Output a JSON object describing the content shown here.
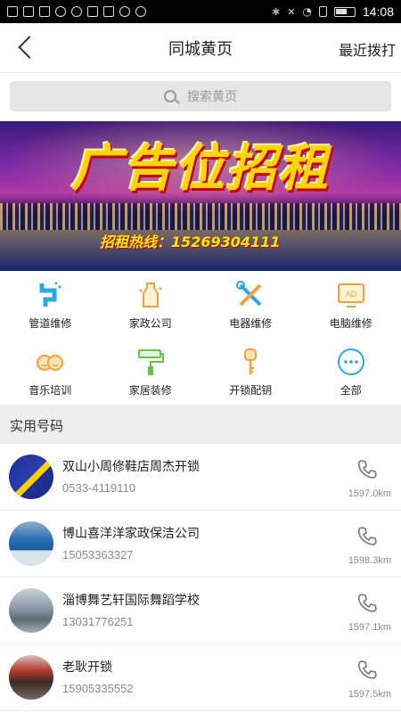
{
  "statusbar": {
    "time": "14:08"
  },
  "header": {
    "title": "同城黄页",
    "recent": "最近拨打"
  },
  "search": {
    "placeholder": "搜索黄页"
  },
  "banner": {
    "headline": "广告位招租",
    "hotline": "招租热线：15269304111"
  },
  "categories": [
    {
      "label": "管道维修",
      "icon": "pipe-icon"
    },
    {
      "label": "家政公司",
      "icon": "spray-bottle-icon"
    },
    {
      "label": "电器维修",
      "icon": "tools-icon"
    },
    {
      "label": "电脑维修",
      "icon": "monitor-ad-icon"
    },
    {
      "label": "音乐培训",
      "icon": "kids-icon"
    },
    {
      "label": "家居装修",
      "icon": "paint-roller-icon"
    },
    {
      "label": "开锁配钥",
      "icon": "key-icon"
    },
    {
      "label": "全部",
      "icon": "more-icon"
    }
  ],
  "section": {
    "title": "实用号码"
  },
  "listings": [
    {
      "name": "双山小周修鞋店周杰开锁",
      "phone": "0533-4119110",
      "distance": "1597.0km"
    },
    {
      "name": "博山喜洋洋家政保洁公司",
      "phone": "15053363327",
      "distance": "1598.3km"
    },
    {
      "name": "淄博舞艺轩国际舞蹈学校",
      "phone": "13031776251",
      "distance": "1597.1km"
    },
    {
      "name": "老耿开锁",
      "phone": "15905335552",
      "distance": "1597.5km"
    }
  ],
  "colors": {
    "accent": "#2aa8e0",
    "orange": "#f0a040",
    "green": "#6ac14a"
  }
}
